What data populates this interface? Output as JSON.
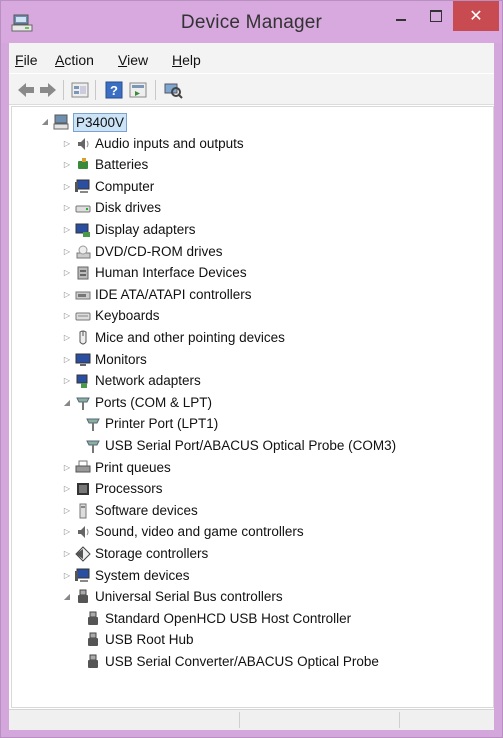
{
  "window": {
    "title": "Device Manager",
    "controls": {
      "minimize": "–",
      "maximize": "□",
      "close": "✕"
    }
  },
  "menubar": {
    "items": [
      {
        "label": "File",
        "mnemonic": "F",
        "rest": "ile"
      },
      {
        "label": "Action",
        "mnemonic": "A",
        "rest": "ction"
      },
      {
        "label": "View",
        "mnemonic": "V",
        "rest": "iew"
      },
      {
        "label": "Help",
        "mnemonic": "H",
        "rest": "elp"
      }
    ]
  },
  "toolbar": {
    "buttons": [
      "back-arrow-icon",
      "forward-arrow-icon",
      "properties-icon",
      "help-icon",
      "action-pane-icon",
      "scan-hardware-icon"
    ]
  },
  "tree": {
    "root": {
      "label": "P3400V",
      "expanded": true
    },
    "items": [
      {
        "label": "Audio inputs and outputs",
        "icon": "speaker-icon",
        "expanded": false
      },
      {
        "label": "Batteries",
        "icon": "battery-icon",
        "expanded": false
      },
      {
        "label": "Computer",
        "icon": "computer-icon",
        "expanded": false
      },
      {
        "label": "Disk drives",
        "icon": "disk-drive-icon",
        "expanded": false
      },
      {
        "label": "Display adapters",
        "icon": "display-adapter-icon",
        "expanded": false
      },
      {
        "label": "DVD/CD-ROM drives",
        "icon": "dvd-drive-icon",
        "expanded": false
      },
      {
        "label": "Human Interface Devices",
        "icon": "hid-icon",
        "expanded": false
      },
      {
        "label": "IDE ATA/ATAPI controllers",
        "icon": "ide-controller-icon",
        "expanded": false
      },
      {
        "label": "Keyboards",
        "icon": "keyboard-icon",
        "expanded": false
      },
      {
        "label": "Mice and other pointing devices",
        "icon": "mouse-icon",
        "expanded": false
      },
      {
        "label": "Monitors",
        "icon": "monitor-icon",
        "expanded": false
      },
      {
        "label": "Network adapters",
        "icon": "network-adapter-icon",
        "expanded": false
      },
      {
        "label": "Ports (COM & LPT)",
        "icon": "port-icon",
        "expanded": true,
        "children": [
          {
            "label": "Printer Port (LPT1)",
            "icon": "port-icon"
          },
          {
            "label": "USB Serial Port/ABACUS Optical Probe (COM3)",
            "icon": "port-icon"
          }
        ]
      },
      {
        "label": "Print queues",
        "icon": "printer-icon",
        "expanded": false
      },
      {
        "label": "Processors",
        "icon": "processor-icon",
        "expanded": false
      },
      {
        "label": "Software devices",
        "icon": "software-device-icon",
        "expanded": false
      },
      {
        "label": "Sound, video and game controllers",
        "icon": "speaker-icon",
        "expanded": false
      },
      {
        "label": "Storage controllers",
        "icon": "storage-controller-icon",
        "expanded": false
      },
      {
        "label": "System devices",
        "icon": "computer-icon",
        "expanded": false
      },
      {
        "label": "Universal Serial Bus controllers",
        "icon": "usb-icon",
        "expanded": true,
        "children": [
          {
            "label": "Standard OpenHCD USB Host Controller",
            "icon": "usb-icon"
          },
          {
            "label": "USB Root Hub",
            "icon": "usb-icon"
          },
          {
            "label": "USB Serial Converter/ABACUS Optical Probe",
            "icon": "usb-icon"
          }
        ]
      }
    ]
  },
  "statusbar": {
    "panes": [
      "",
      "",
      ""
    ]
  },
  "colors": {
    "titlebar": "#d7a9df",
    "close": "#c74b50",
    "selection": "#cce4f7"
  }
}
